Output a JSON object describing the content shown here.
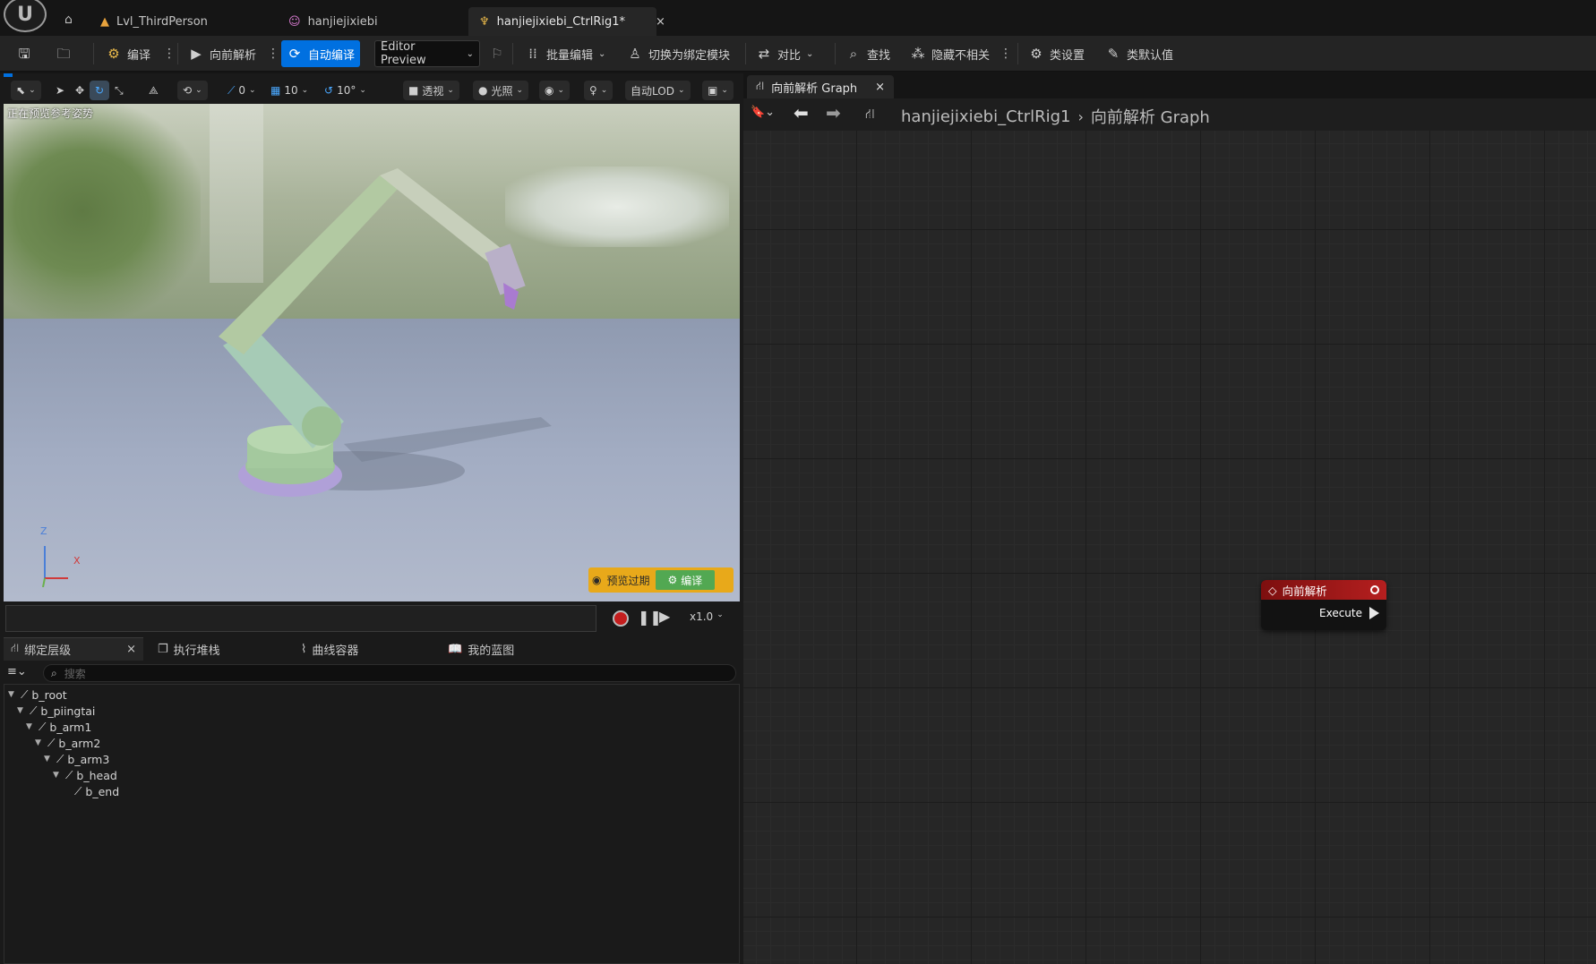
{
  "titlebar": {
    "tabs": [
      {
        "label": "Lvl_ThirdPerson",
        "icon": "level-icon"
      },
      {
        "label": "hanjiejixiebi",
        "icon": "skeleton-icon"
      },
      {
        "label": "hanjiejixiebi_CtrlRig1*",
        "icon": "control-rig-icon",
        "active": true
      }
    ],
    "close_glyph": "×"
  },
  "toolbar": {
    "compile": "编译",
    "forward_solve": "向前解析",
    "auto_compile": "自动编译",
    "editor_preview": "Editor Preview",
    "batch_edit": "批量编辑",
    "switch_binding": "切换为绑定模块",
    "diff": "对比",
    "find": "查找",
    "hide_unrelated": "隐藏不相关",
    "class_settings": "类设置",
    "class_defaults": "类默认值"
  },
  "viewport_toolbar": {
    "snap_translate": "0",
    "grid_size": "10",
    "rotate_snap": "10°",
    "perspective": "透视",
    "lit": "光照",
    "lod": "自动LOD"
  },
  "viewport": {
    "status": "正在预览参考姿势",
    "axis_z": "Z",
    "axis_x": "X",
    "preview_expired": "预览过期",
    "compile_button": "编译"
  },
  "timeline": {
    "speed": "x1.0"
  },
  "bottom_tabs": [
    {
      "label": "绑定层级",
      "active": true
    },
    {
      "label": "执行堆栈"
    },
    {
      "label": "曲线容器"
    },
    {
      "label": "我的蓝图"
    }
  ],
  "hierarchy": {
    "search_placeholder": "搜索",
    "items": [
      "b_root",
      "b_piingtai",
      "b_arm1",
      "b_arm2",
      "b_arm3",
      "b_head",
      "b_end"
    ]
  },
  "graph": {
    "tab_label": "向前解析 Graph",
    "breadcrumb_asset": "hanjiejixiebi_CtrlRig1",
    "breadcrumb_graph": "向前解析 Graph",
    "node_title": "向前解析",
    "node_pin": "Execute",
    "node_color": "#b51f1f"
  }
}
